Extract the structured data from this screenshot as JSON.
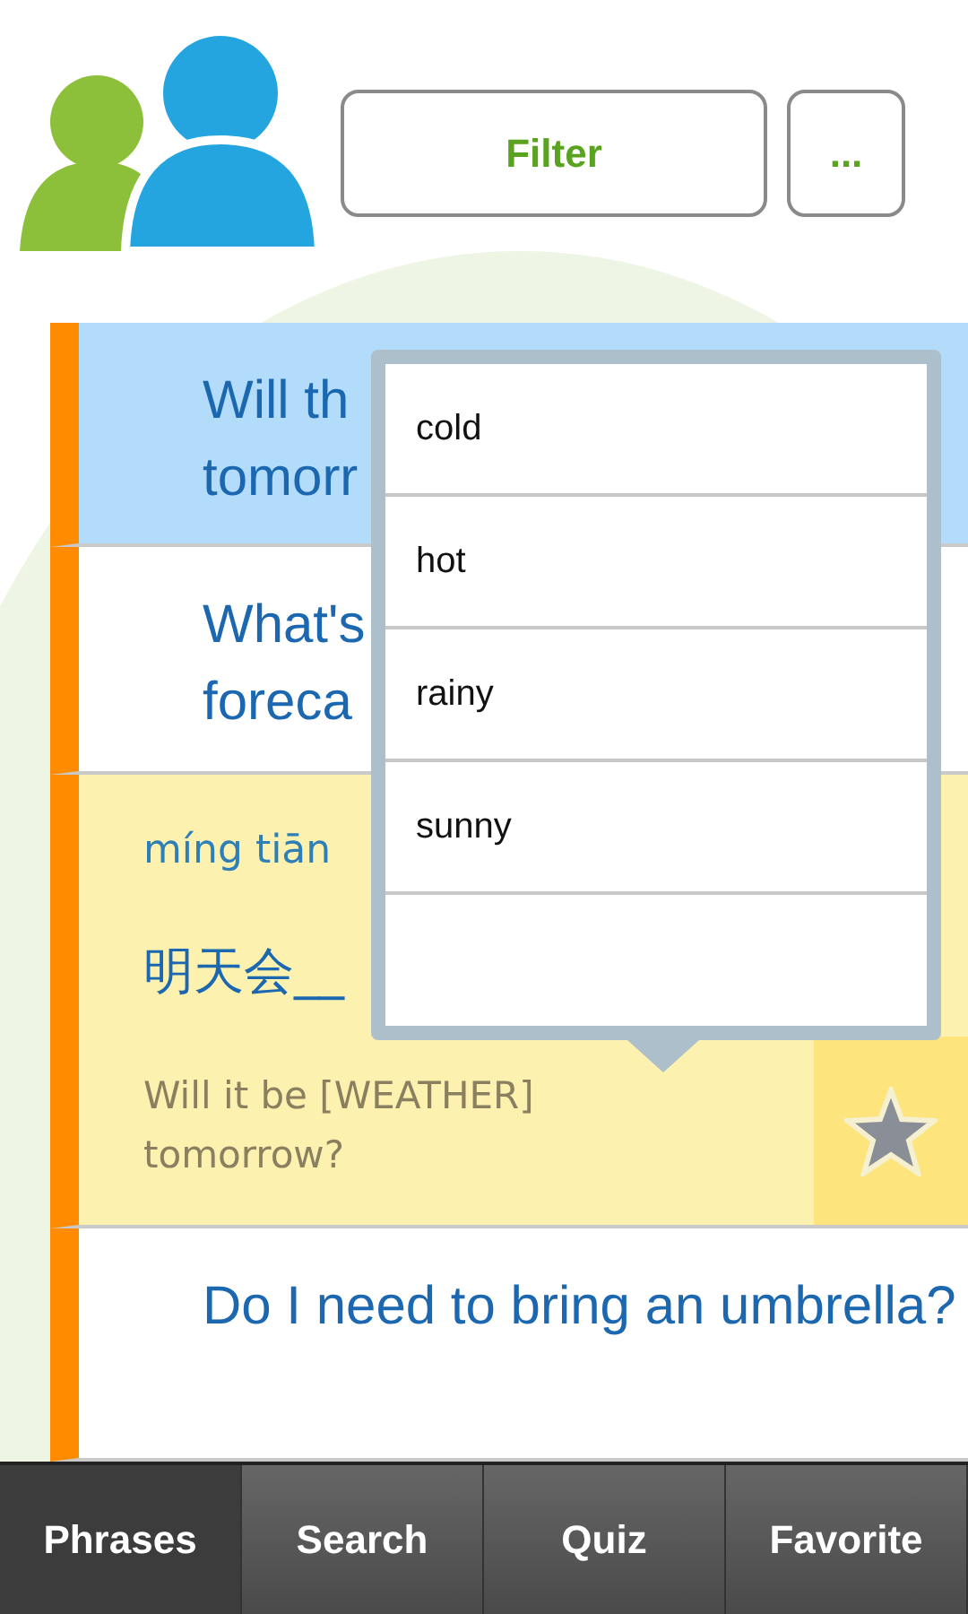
{
  "header": {
    "filter_button": "Filter",
    "more_button": "..."
  },
  "rows": [
    {
      "kind": "collapsed",
      "selected": true,
      "text": "Will th\ntomorr"
    },
    {
      "kind": "collapsed",
      "selected": false,
      "text": "What's\nforeca"
    },
    {
      "kind": "expanded",
      "selected": false,
      "pinyin": "míng tiān",
      "hanzi": "明天会__",
      "english": "Will it be [WEATHER] tomorrow?"
    },
    {
      "kind": "collapsed",
      "selected": false,
      "text": "Do I need to bring an umbrella?"
    }
  ],
  "dropdown": {
    "options": [
      "cold",
      "hot",
      "rainy",
      "sunny"
    ]
  },
  "tabs": [
    {
      "label": "Phrases",
      "selected": true
    },
    {
      "label": "Search",
      "selected": false
    },
    {
      "label": "Quiz",
      "selected": false
    },
    {
      "label": "Favorite",
      "selected": false
    }
  ]
}
